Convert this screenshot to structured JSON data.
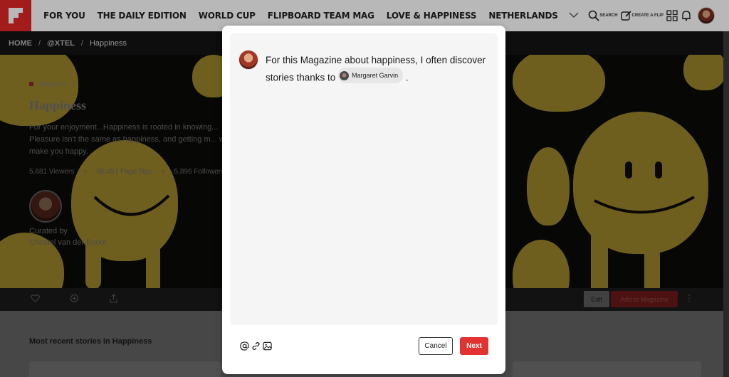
{
  "nav": {
    "items": [
      "FOR YOU",
      "THE DAILY EDITION",
      "WORLD CUP",
      "FLIPBOARD TEAM MAG",
      "LOVE & HAPPINESS",
      "NETHERLANDS"
    ],
    "search_label": "SEARCH",
    "create_label": "CREATE A FLIP",
    "brand_color": "#e12828"
  },
  "breadcrumb": [
    "HOME",
    "@XTEL",
    "Happiness"
  ],
  "magazine": {
    "tag": "Magazine",
    "title": "Happiness",
    "description": "For your enjoyment...Happiness is rooted in knowing... Pleasure isn't the same as happiness, and getting m... will make you happy.",
    "stats": [
      "5,681 Viewers",
      "85,451 Page flips",
      "5,896 Followers"
    ],
    "curated_by_label": "Curated by",
    "curator_name": "Christel van der Boom",
    "edit_label": "Edit",
    "add_label": "Add to Magazine"
  },
  "section": {
    "recent_title": "Most recent stories in Happiness"
  },
  "modal": {
    "text_before": "For this Magazine about happiness, I often discover stories thanks to",
    "mention_name": "Margaret Garvin",
    "text_after": ".",
    "cancel_label": "Cancel",
    "next_label": "Next",
    "next_color": "#e23232"
  }
}
